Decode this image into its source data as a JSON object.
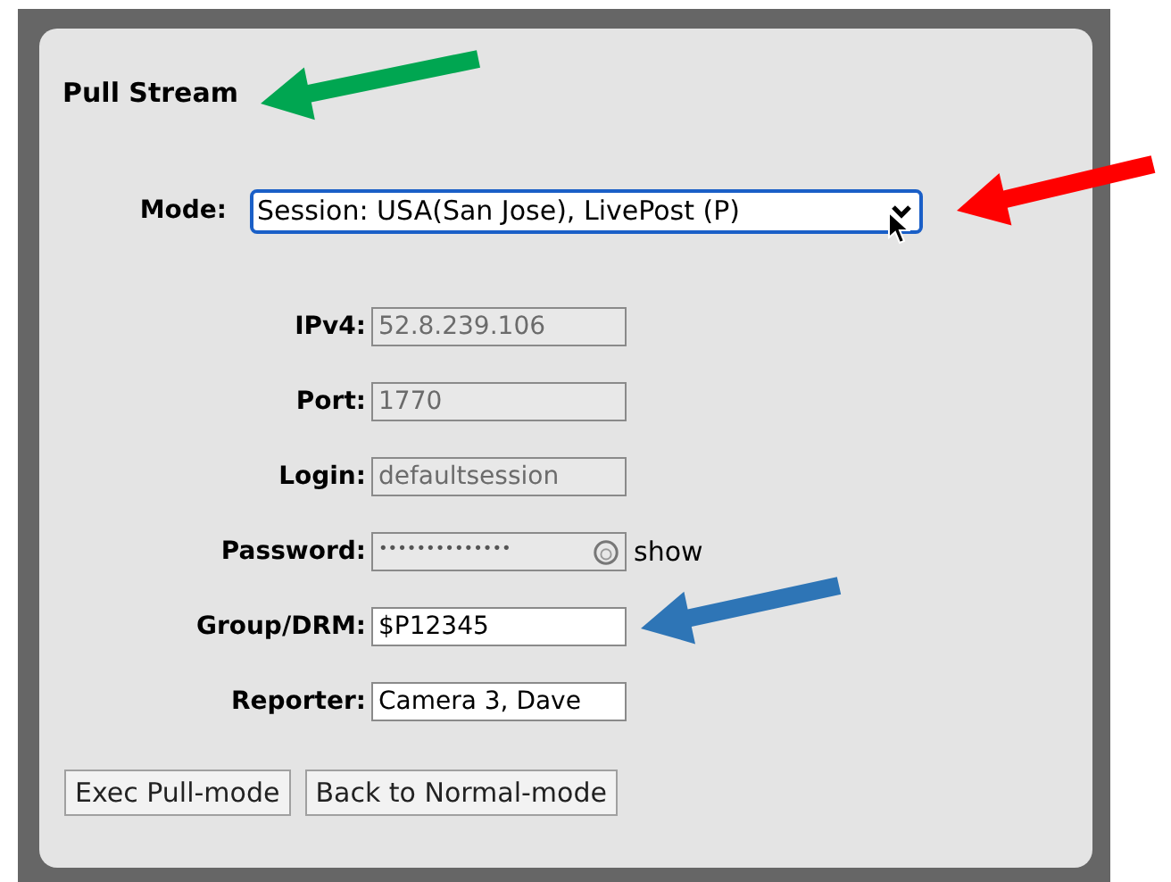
{
  "title": "Pull Stream",
  "mode": {
    "label": "Mode:",
    "value": "Session: USA(San Jose), LivePost (P)"
  },
  "fields": [
    {
      "label": "IPv4:",
      "value": "52.8.239.106",
      "disabled": true
    },
    {
      "label": "Port:",
      "value": "1770",
      "disabled": true
    },
    {
      "label": "Login:",
      "value": "defaultsession",
      "disabled": true
    },
    {
      "label": "Password:",
      "value": "••••••••••••••",
      "disabled": true,
      "kind": "password",
      "toggle": "show"
    },
    {
      "label": "Group/DRM:",
      "value": "$P12345",
      "disabled": false
    },
    {
      "label": "Reporter:",
      "value": "Camera 3, Dave",
      "disabled": false
    }
  ],
  "buttons": [
    "Exec Pull-mode",
    "Back to Normal-mode"
  ],
  "arrows": [
    {
      "color": "#00a651"
    },
    {
      "color": "#ff0000"
    },
    {
      "color": "#2e75b6"
    }
  ]
}
